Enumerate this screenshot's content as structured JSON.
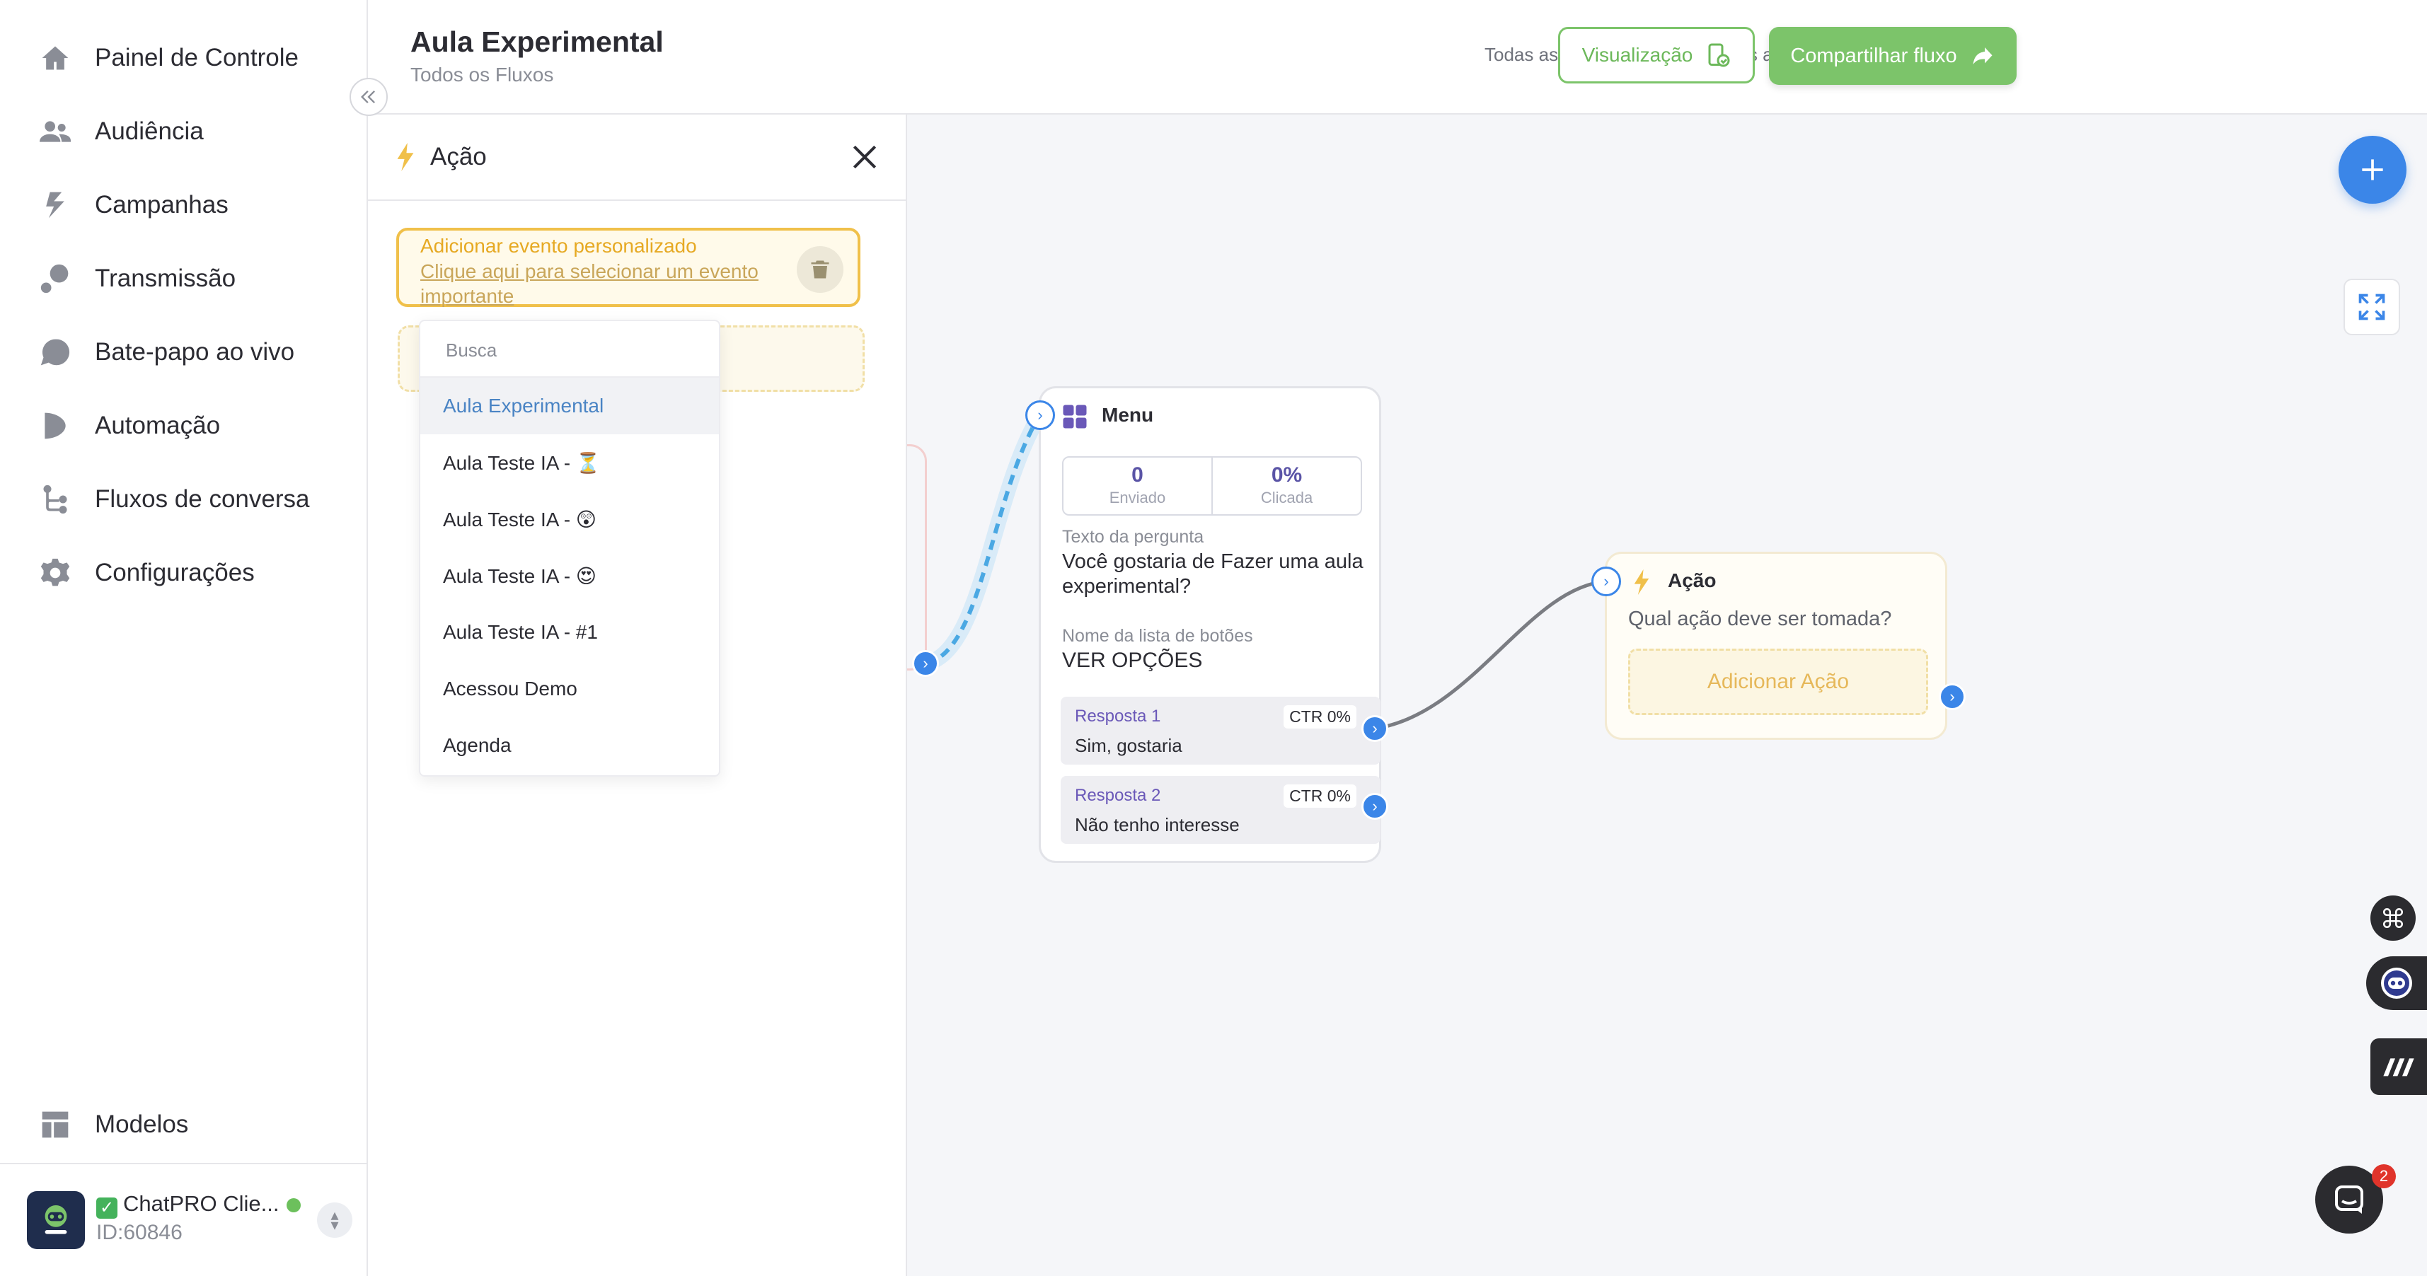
{
  "sidebar": {
    "items": [
      {
        "label": "Painel de Controle",
        "icon": "home-icon"
      },
      {
        "label": "Audiência",
        "icon": "users-icon"
      },
      {
        "label": "Campanhas",
        "icon": "campaign-icon"
      },
      {
        "label": "Transmissão",
        "icon": "broadcast-icon"
      },
      {
        "label": "Bate-papo ao vivo",
        "icon": "chat-bubble-icon"
      },
      {
        "label": "Automação",
        "icon": "automation-icon"
      },
      {
        "label": "Fluxos de conversa",
        "icon": "flow-icon"
      },
      {
        "label": "Configurações",
        "icon": "gear-icon"
      }
    ],
    "templates_label": "Modelos",
    "account": {
      "name": "ChatPRO Clie...",
      "id": "ID:60846"
    }
  },
  "header": {
    "title": "Aula Experimental",
    "breadcrumb": "Todos os Fluxos",
    "autosave": "Todas as alterações foram salvas automaticamente",
    "preview_label": "Visualização",
    "share_label": "Compartilhar fluxo"
  },
  "panel": {
    "title": "Ação",
    "event_label": "Adicionar evento personalizado",
    "event_link": "Clique aqui para selecionar um evento importante",
    "dropdown": {
      "search_placeholder": "Busca",
      "options": [
        "Aula Experimental",
        "Aula Teste IA - ⏳",
        "Aula Teste IA - 😲",
        "Aula Teste IA - 😍",
        "Aula Teste IA - #1",
        "Acessou Demo",
        "Agenda"
      ],
      "selected": "Aula Experimental"
    }
  },
  "menu_node": {
    "title": "Menu",
    "sent_value": "0",
    "sent_label": "Enviado",
    "click_value": "0%",
    "click_label": "Clicada",
    "question_label": "Texto da pergunta",
    "question_text": "Você gostaria de Fazer uma aula experimental?",
    "button_list_label": "Nome da lista de botões",
    "button_list_text": "VER OPÇÕES",
    "responses": [
      {
        "label": "Resposta 1",
        "text": "Sim, gostaria",
        "ctr": "CTR 0%"
      },
      {
        "label": "Resposta 2",
        "text": "Não tenho interesse",
        "ctr": "CTR 0%"
      }
    ]
  },
  "action_node": {
    "title": "Ação",
    "question": "Qual ação deve ser tomada?",
    "add_label": "Adicionar Ação"
  },
  "chat": {
    "badge": "2"
  },
  "colors": {
    "accent_green": "#7cc46a",
    "accent_blue": "#3b86e8",
    "accent_yellow": "#f0c04a",
    "menu_purple": "#6a58b8"
  }
}
